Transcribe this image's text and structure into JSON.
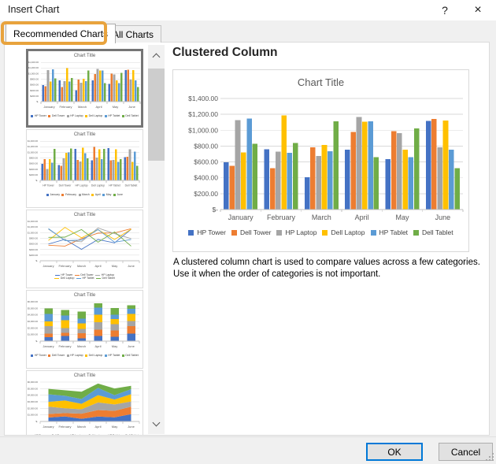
{
  "window": {
    "title": "Insert Chart",
    "help_icon": "?",
    "close_icon": "×"
  },
  "tabs": {
    "recommended": "Recommended Charts",
    "all": "All Charts",
    "highlight_color": "#E8A33D"
  },
  "sidebar": {
    "thumbnails": [
      {
        "name": "clustered-column",
        "type": "clustered",
        "by": "month",
        "selected": true,
        "title": "Chart Title"
      },
      {
        "name": "clustered-column-by-product",
        "type": "clustered",
        "by": "product",
        "selected": false,
        "title": "Chart Title"
      },
      {
        "name": "line-chart",
        "type": "line",
        "by": "month",
        "selected": false,
        "title": "Chart Title"
      },
      {
        "name": "stacked-column",
        "type": "stacked",
        "by": "month",
        "selected": false,
        "title": "Chart Title"
      },
      {
        "name": "stacked-area",
        "type": "area",
        "by": "month",
        "selected": false,
        "title": "Chart Title"
      }
    ]
  },
  "preview": {
    "heading": "Clustered Column",
    "description_line1": "A clustered column chart is used to compare values across a few categories.",
    "description_line2": "Use it when the order of categories is not important."
  },
  "chart_data": {
    "type": "bar",
    "title": "Chart Title",
    "categories": [
      "January",
      "February",
      "March",
      "April",
      "May",
      "June"
    ],
    "series": [
      {
        "name": "HP Tower",
        "color": "#4472C4",
        "values": [
          595,
          760,
          405,
          755,
          635,
          1115
        ]
      },
      {
        "name": "Dell Tower",
        "color": "#ED7D31",
        "values": [
          550,
          520,
          785,
          980,
          990,
          1140
        ]
      },
      {
        "name": "HP Laptop",
        "color": "#A5A5A5",
        "values": [
          1125,
          730,
          675,
          1165,
          965,
          785
        ]
      },
      {
        "name": "Dell Laptop",
        "color": "#FFC000",
        "values": [
          720,
          1185,
          815,
          1105,
          755,
          1120
        ]
      },
      {
        "name": "HP Tablet",
        "color": "#5B9BD5",
        "values": [
          1145,
          715,
          735,
          1110,
          660,
          755
        ]
      },
      {
        "name": "Dell Tablet",
        "color": "#70AD47",
        "values": [
          830,
          840,
          1110,
          660,
          1025,
          520
        ]
      }
    ],
    "ylim": [
      0,
      1400
    ],
    "ytick_step": 200,
    "ytick_labels": [
      "$-",
      "$200.00",
      "$400.00",
      "$600.00",
      "$800.00",
      "$1,000.00",
      "$1,200.00",
      "$1,400.00"
    ],
    "grid": true,
    "legend_position": "bottom"
  },
  "footer": {
    "ok": "OK",
    "cancel": "Cancel"
  }
}
